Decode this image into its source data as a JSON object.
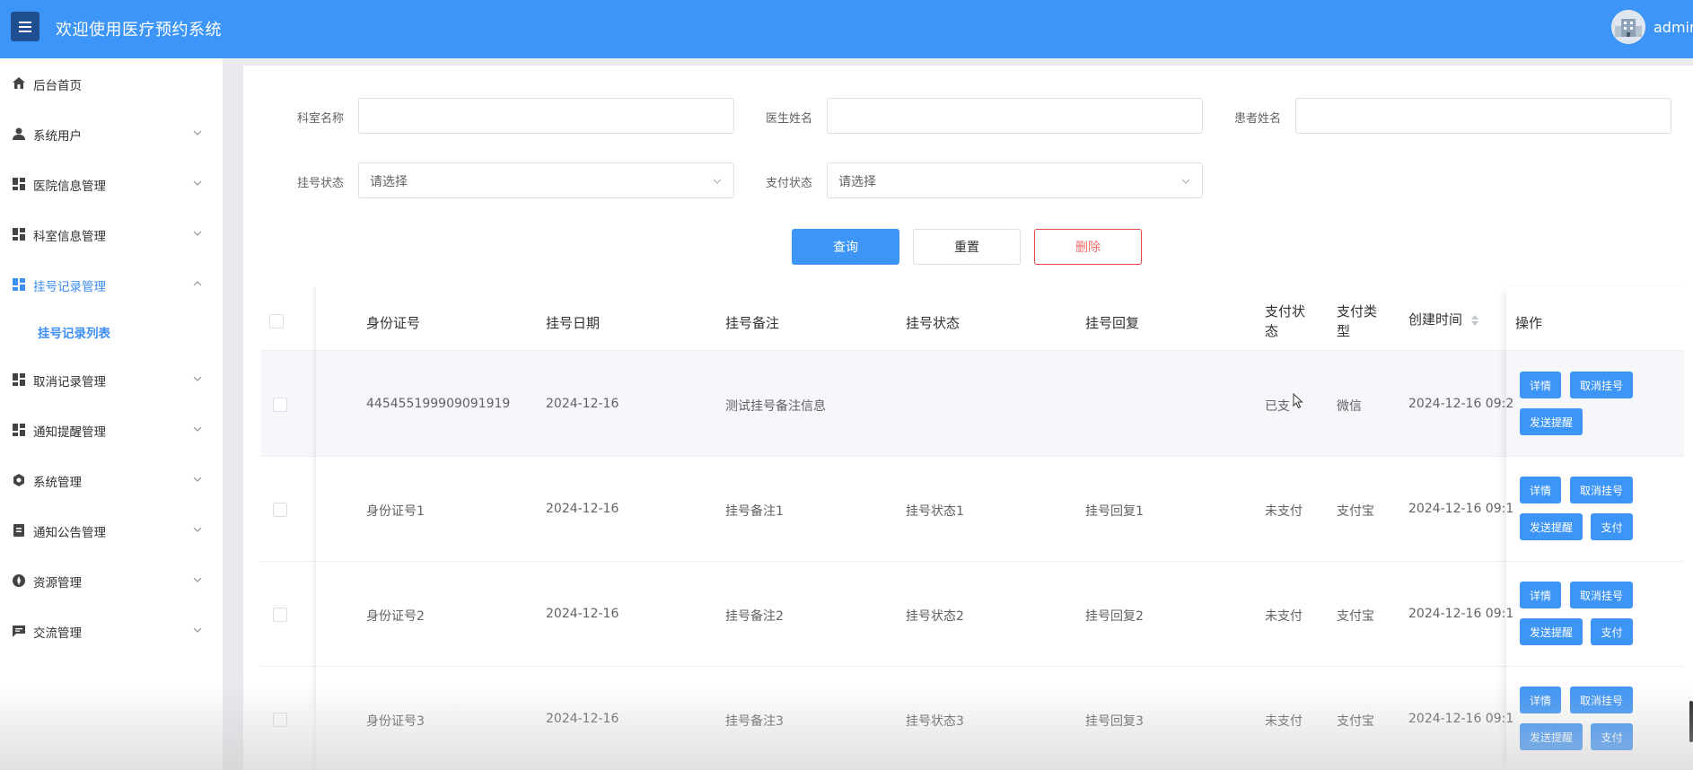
{
  "header": {
    "title": "欢迎使用医疗预约系统",
    "user": "admin"
  },
  "sidebar": {
    "items": [
      {
        "label": "后台首页",
        "icon": "home-icon",
        "expandable": false
      },
      {
        "label": "系统用户",
        "icon": "user-icon",
        "expandable": true
      },
      {
        "label": "医院信息管理",
        "icon": "grid-icon",
        "expandable": true
      },
      {
        "label": "科室信息管理",
        "icon": "grid-icon",
        "expandable": true
      },
      {
        "label": "挂号记录管理",
        "icon": "grid-icon",
        "expandable": true,
        "active": true
      },
      {
        "label": "取消记录管理",
        "icon": "grid-icon",
        "expandable": true
      },
      {
        "label": "通知提醒管理",
        "icon": "grid-icon",
        "expandable": true
      },
      {
        "label": "系统管理",
        "icon": "gear-icon",
        "expandable": true
      },
      {
        "label": "通知公告管理",
        "icon": "document-icon",
        "expandable": true
      },
      {
        "label": "资源管理",
        "icon": "compass-icon",
        "expandable": true
      },
      {
        "label": "交流管理",
        "icon": "chat-icon",
        "expandable": true
      }
    ],
    "sub_item": "挂号记录列表"
  },
  "filters": {
    "dept_label": "科室名称",
    "doctor_label": "医生姓名",
    "patient_label": "患者姓名",
    "reg_status_label": "挂号状态",
    "reg_status_placeholder": "请选择",
    "pay_status_label": "支付状态",
    "pay_status_placeholder": "请选择"
  },
  "actions": {
    "query": "查询",
    "reset": "重置",
    "delete": "删除"
  },
  "table": {
    "headers": {
      "id_card": "身份证号",
      "date": "挂号日期",
      "note": "挂号备注",
      "status": "挂号状态",
      "reply": "挂号回复",
      "pay_status": "支付状态",
      "pay_type": "支付类型",
      "created": "创建时间",
      "ops": "操作"
    },
    "rows": [
      {
        "id_card": "445455199909091919",
        "date": "2024-12-16",
        "note": "测试挂号备注信息",
        "status": "",
        "reply": "",
        "pay_status": "已支",
        "pay_type": "微信",
        "created": "2024-12-16 09:2"
      },
      {
        "id_card": "身份证号1",
        "date": "2024-12-16",
        "note": "挂号备注1",
        "status": "挂号状态1",
        "reply": "挂号回复1",
        "pay_status": "未支付",
        "pay_type": "支付宝",
        "created": "2024-12-16 09:1"
      },
      {
        "id_card": "身份证号2",
        "date": "2024-12-16",
        "note": "挂号备注2",
        "status": "挂号状态2",
        "reply": "挂号回复2",
        "pay_status": "未支付",
        "pay_type": "支付宝",
        "created": "2024-12-16 09:1"
      },
      {
        "id_card": "身份证号3",
        "date": "2024-12-16",
        "note": "挂号备注3",
        "status": "挂号状态3",
        "reply": "挂号回复3",
        "pay_status": "未支付",
        "pay_type": "支付宝",
        "created": "2024-12-16 09:1"
      }
    ],
    "op_labels": {
      "detail": "详情",
      "cancel": "取消挂号",
      "remind": "发送提醒",
      "pay": "支付"
    }
  },
  "colors": {
    "primary": "#3d95f7",
    "danger": "#f56c6c",
    "sidebar_active": "#3d8ef5"
  }
}
